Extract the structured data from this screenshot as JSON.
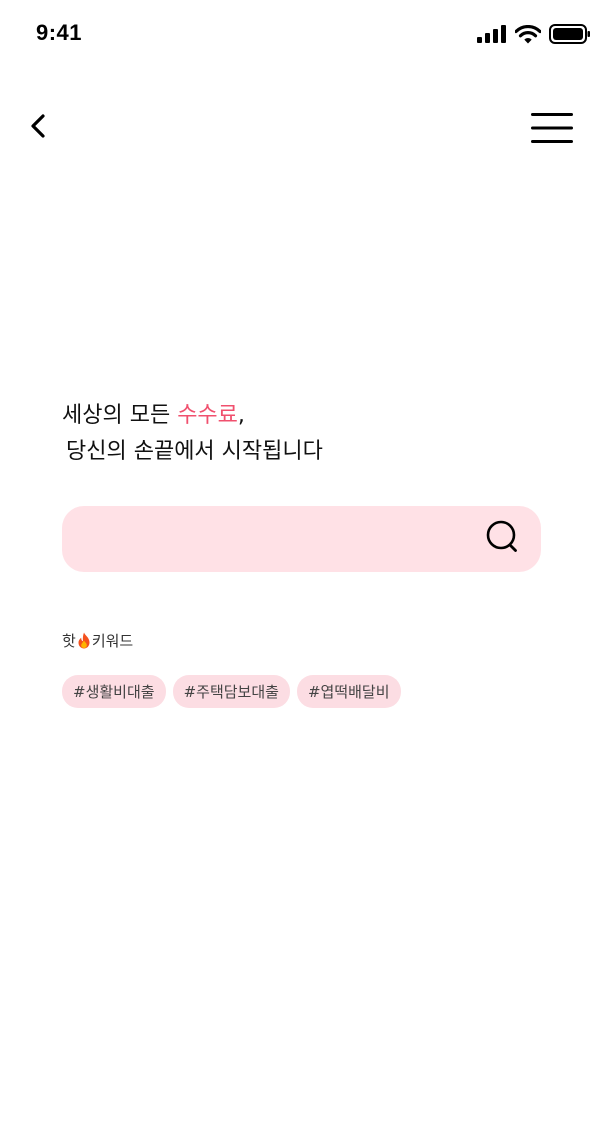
{
  "status_bar": {
    "time": "9:41",
    "icons": [
      "cellular-signal-icon",
      "wifi-icon",
      "battery-icon"
    ]
  },
  "nav": {
    "back_icon": "chevron-left-icon",
    "menu_icon": "hamburger-menu-icon"
  },
  "headline": {
    "line1_prefix": "세상의 모든 ",
    "line1_accent": "수수료",
    "line1_suffix": ",",
    "line2": "당신의 손끝에서 시작됩니다",
    "accent_color": "#f0506e"
  },
  "search": {
    "value": "",
    "placeholder": "",
    "icon": "search-icon",
    "background_color": "#ffe1e6"
  },
  "hot_keywords": {
    "label_prefix": "핫",
    "label_icon": "fire-icon",
    "label_suffix": "키워드",
    "tags": [
      "#생활비대출",
      "#주택담보대출",
      "#엽떡배달비"
    ],
    "tag_color": "#fcdde3"
  }
}
